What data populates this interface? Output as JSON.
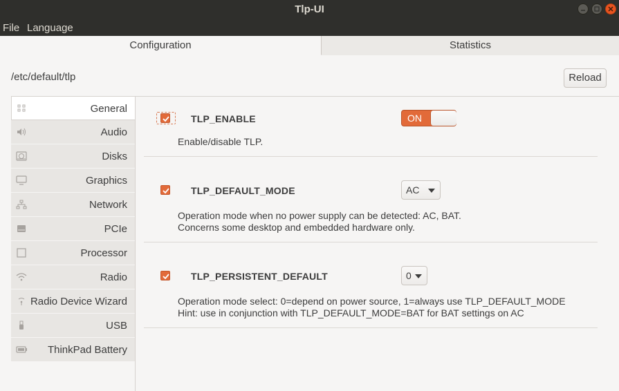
{
  "window": {
    "title": "Tlp-UI"
  },
  "menu": {
    "file": "File",
    "language": "Language"
  },
  "tabs": [
    {
      "label": "Configuration",
      "active": true
    },
    {
      "label": "Statistics",
      "active": false
    }
  ],
  "config_path": "/etc/default/tlp",
  "reload_label": "Reload",
  "sidebar": {
    "items": [
      {
        "label": "General",
        "icon": "grid-icon",
        "active": true
      },
      {
        "label": "Audio",
        "icon": "speaker-icon"
      },
      {
        "label": "Disks",
        "icon": "disk-icon"
      },
      {
        "label": "Graphics",
        "icon": "monitor-icon"
      },
      {
        "label": "Network",
        "icon": "network-icon"
      },
      {
        "label": "PCIe",
        "icon": "pcie-icon"
      },
      {
        "label": "Processor",
        "icon": "processor-icon"
      },
      {
        "label": "Radio",
        "icon": "wifi-icon"
      },
      {
        "label": "Radio Device Wizard",
        "icon": "wizard-icon"
      },
      {
        "label": "USB",
        "icon": "usb-icon"
      },
      {
        "label": "ThinkPad Battery",
        "icon": "battery-icon"
      }
    ]
  },
  "settings": [
    {
      "key": "TLP_ENABLE",
      "checked": true,
      "control": "switch",
      "switch_text": "ON",
      "description": [
        "Enable/disable TLP."
      ]
    },
    {
      "key": "TLP_DEFAULT_MODE",
      "checked": true,
      "control": "combo",
      "value": "AC",
      "description": [
        "Operation mode when no power supply can be detected: AC, BAT.",
        "Concerns some desktop and embedded hardware only."
      ]
    },
    {
      "key": "TLP_PERSISTENT_DEFAULT",
      "checked": true,
      "control": "combo",
      "value": "0",
      "description": [
        "Operation mode select: 0=depend on power source, 1=always use TLP_DEFAULT_MODE",
        "Hint: use in conjunction with TLP_DEFAULT_MODE=BAT for BAT settings on AC"
      ]
    }
  ],
  "colors": {
    "accent": "#e26a39",
    "titlebar": "#2f2f2c",
    "close": "#e95420"
  }
}
